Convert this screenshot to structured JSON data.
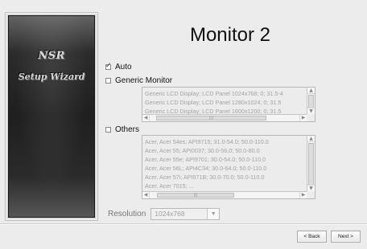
{
  "sidebar": {
    "logo_text": "NSR",
    "subtitle": "Setup Wizard"
  },
  "main": {
    "title": "Monitor 2",
    "options": {
      "auto_label": "Auto",
      "generic_label": "Generic Monitor",
      "others_label": "Others",
      "auto_checked": true,
      "generic_checked": false,
      "others_checked": false
    },
    "generic_list": {
      "items": [
        "Generic LCD Display; LCD Panel 1024x768; 0; 31.5-4",
        "Generic LCD Display; LCD Panel 1280x1024; 0; 31.5",
        "Generic LCD Display; LCD Panel 1600x1200; 0; 31.5"
      ]
    },
    "others_list": {
      "items": [
        "Acer, Acer 54es; API9715; 31.0-54.0; 50.0-110.0",
        "Acer, Acer 55; API0037; 30.0-56.0; 50.0-80.0",
        "Acer, Acer 55e; API9701; 30.0-54.0; 50.0-110.0",
        "Acer, Acer 56L; API4C34; 30.0-64.0; 50.0-110.0",
        "Acer, Acer 57i; API971B; 30.0-70.0; 50.0-110.0",
        "Acer, Acer 7015; ..."
      ]
    },
    "resolution": {
      "label": "Resolution",
      "value": "1024x768"
    }
  },
  "footer": {
    "back_label": "< Back",
    "next_label": "Next >"
  },
  "icons": {
    "checkbox_checked": "check-icon",
    "dropdown": "triangle-down-icon",
    "scroll_up": "triangle-up-icon",
    "scroll_down": "triangle-down-icon",
    "scroll_left": "triangle-left-icon",
    "scroll_right": "triangle-right-icon"
  }
}
